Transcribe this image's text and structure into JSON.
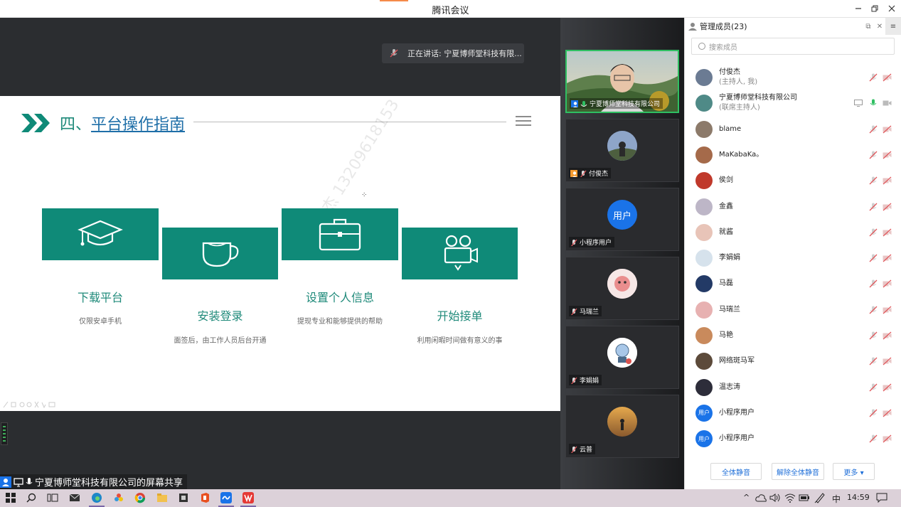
{
  "window": {
    "title": "腾讯会议"
  },
  "speaking": {
    "text": "正在讲话: 宁夏博师堂科技有限..."
  },
  "slide": {
    "prefix": "四、",
    "title": "平台操作指南",
    "watermark": "付俊杰 13209618153",
    "steps": [
      {
        "title": "下载平台",
        "subtitle": "仅限安卓手机",
        "icon": "graduation-cap-icon"
      },
      {
        "title": "安装登录",
        "subtitle": "面签后，由工作人员后台开通",
        "icon": "teacup-icon"
      },
      {
        "title": "设置个人信息",
        "subtitle": "提现专业和能够提供的帮助",
        "icon": "briefcase-icon"
      },
      {
        "title": "开始接单",
        "subtitle": "利用闲暇时间做有意义的事",
        "icon": "video-camera-icon"
      }
    ],
    "accent": "#0f8a78"
  },
  "share": {
    "label": "宁夏博师堂科技有限公司的屏幕共享"
  },
  "videos": [
    {
      "name": "宁夏博师堂科技有限公司",
      "type": "camera"
    },
    {
      "name": "付俊杰",
      "type": "avatar"
    },
    {
      "name": "小程序用户",
      "type": "default",
      "avatar_text": "用户"
    },
    {
      "name": "马瑞兰",
      "type": "avatar"
    },
    {
      "name": "李娟娟",
      "type": "avatar"
    },
    {
      "name": "云普",
      "type": "avatar"
    }
  ],
  "panel": {
    "title": "管理成员(23)",
    "search_placeholder": "搜索成员",
    "members": [
      {
        "name": "付俊杰",
        "role": "(主持人, 我)"
      },
      {
        "name": "宁夏博师堂科技有限公司",
        "role": "(联席主持人)"
      },
      {
        "name": "blame",
        "role": ""
      },
      {
        "name": "MaKabaKa。",
        "role": ""
      },
      {
        "name": "侯剑",
        "role": ""
      },
      {
        "name": "金鑫",
        "role": ""
      },
      {
        "name": "就酱",
        "role": ""
      },
      {
        "name": "李娟娟",
        "role": ""
      },
      {
        "name": "马磊",
        "role": ""
      },
      {
        "name": "马瑞兰",
        "role": ""
      },
      {
        "name": "马艳",
        "role": ""
      },
      {
        "name": "网络斑马军",
        "role": ""
      },
      {
        "name": "温志涛",
        "role": ""
      },
      {
        "name": "小程序用户",
        "role": "",
        "avatar_text": "用户"
      },
      {
        "name": "小程序用户",
        "role": "",
        "avatar_text": "用户"
      }
    ],
    "buttons": {
      "mute_all": "全体静音",
      "unmute_all": "解除全体静音",
      "more": "更多 ▾"
    }
  },
  "taskbar": {
    "ime": "中",
    "time": "14:59",
    "chevron": "^"
  },
  "colors": {
    "brand_blue": "#1a73e8",
    "mic_green": "#2fbf62",
    "mute_red": "#e0575b"
  }
}
